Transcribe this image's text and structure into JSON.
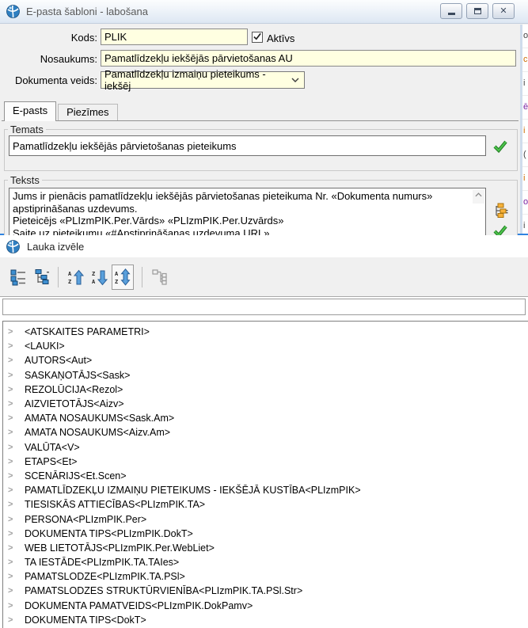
{
  "template_window": {
    "title": "E-pasta šabloni - labošana",
    "fields": {
      "kods_label": "Kods:",
      "kods_value": "PLIK",
      "aktivs_label": "Aktīvs",
      "aktivs_checked": true,
      "nosaukums_label": "Nosaukums:",
      "nosaukums_value": "Pamatlīdzekļu iekšējās pārvietošanas AU",
      "dokumenta_veids_label": "Dokumenta veids:",
      "dokumenta_veids_value": "Pamatlīdzekļu izmaiņu pieteikums - iekšēj"
    },
    "tabs": [
      {
        "label": "E-pasts",
        "active": true
      },
      {
        "label": "Piezīmes",
        "active": false
      }
    ],
    "temats": {
      "group_label": "Temats",
      "value": "Pamatlīdzekļu iekšējās pārvietošanas pieteikums"
    },
    "teksts": {
      "group_label": "Teksts",
      "value": "Jums ir pienācis pamatlīdzekļu iekšējās pārvietošanas pieteikuma Nr. «Dokumenta numurs» apstiprināšanas uzdevums.\nPieteicējs «PLIzmPIK.Per.Vārds» «PLIzmPIK.Per.Uzvārds»\nSaite uz pieteikumu «#Apstiprināšanas uzdevuma URL»"
    },
    "window_buttons": [
      "minimize",
      "restore",
      "close"
    ],
    "side_icons": [
      "insert-field-tree-icon",
      "confirm-check-icon"
    ]
  },
  "field_window": {
    "title": "Lauka izvēle",
    "toolbar_icons": [
      {
        "name": "flat-list-icon"
      },
      {
        "name": "tree-view-icon"
      },
      {
        "name": "sort-ascending-icon"
      },
      {
        "name": "sort-descending-icon"
      },
      {
        "name": "sort-toggle-icon",
        "toggled": true
      },
      {
        "name": "expand-structure-icon",
        "disabled": true
      }
    ],
    "filter_value": "",
    "items": [
      "<ATSKAITES PARAMETRI>",
      "<LAUKI>",
      "AUTORS<Aut>",
      "SASKAŅOTĀJS<Sask>",
      "REZOLŪCIJA<Rezol>",
      "AIZVIETOTĀJS<Aizv>",
      "AMATA NOSAUKUMS<Sask.Am>",
      "AMATA NOSAUKUMS<Aizv.Am>",
      "VALŪTA<V>",
      "ETAPS<Et>",
      "SCENĀRIJS<Et.Scen>",
      "PAMATLĪDZEKĻU IZMAIŅU PIETEIKUMS - IEKŠĒJĀ KUSTĪBA<PLIzmPIK>",
      "TIESISKĀS ATTIECĪBAS<PLIzmPIK.TA>",
      "PERSONA<PLIzmPIK.Per>",
      "DOKUMENTA TIPS<PLIzmPIK.DokT>",
      "WEB LIETOTĀJS<PLIzmPIK.Per.WebLiet>",
      "TA IESTĀDE<PLIzmPIK.TA.TAIes>",
      "PAMATSLODZE<PLIzmPIK.TA.PSl>",
      "PAMATSLODZES STRUKTŪRVIENĪBA<PLIzmPIK.TA.PSl.Str>",
      "DOKUMENTA PAMATVEIDS<PLIzmPIK.DokPamv>",
      "DOKUMENTA TIPS<DokT>"
    ]
  },
  "background_strip": {
    "fragments": [
      "o",
      "c",
      "i",
      "ē",
      "i",
      "(",
      "i",
      "o",
      "i"
    ]
  },
  "colors": {
    "input_yellow": "#ffffe1",
    "accent_blue": "#2f83e0",
    "icon_blue": "#3d8fd1",
    "check_green": "#2e9e2e",
    "folder_yellow": "#f7b239",
    "titlebar_tint": "#dde7f3"
  }
}
